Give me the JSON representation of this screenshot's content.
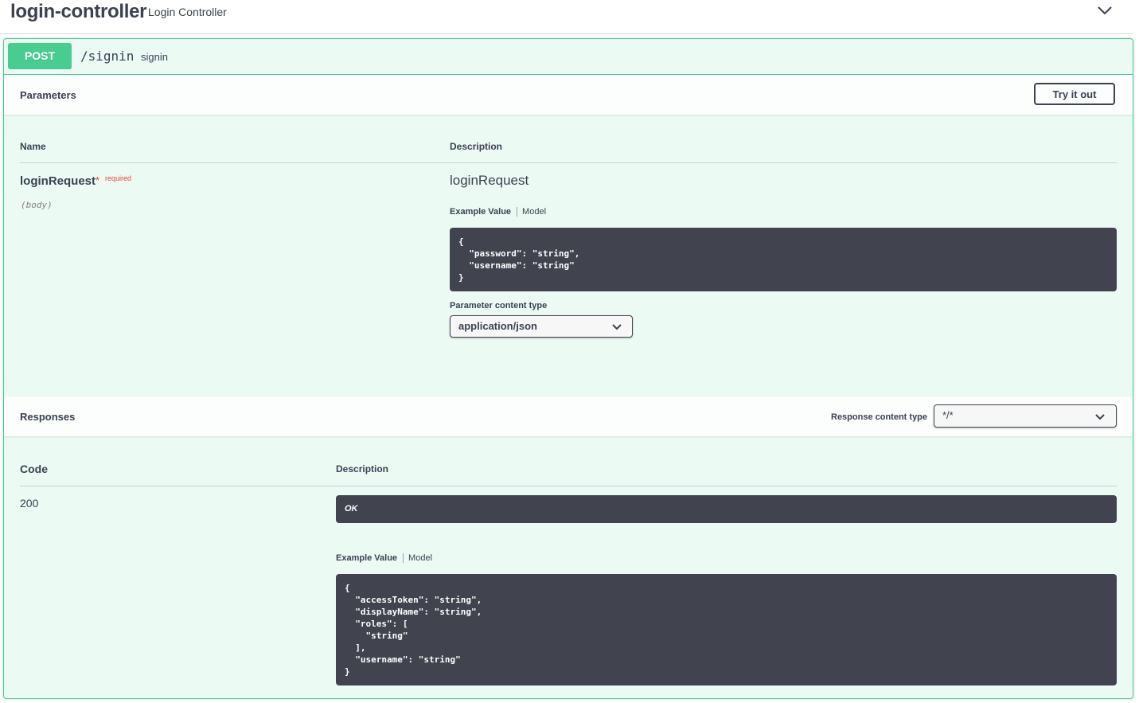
{
  "tag": {
    "name": "login-controller",
    "description": "Login Controller",
    "collapse_icon": "chevron-down-icon"
  },
  "operation": {
    "method": "POST",
    "path": "/signin",
    "summary": "signin",
    "method_color": "#49cc90"
  },
  "parameters": {
    "title": "Parameters",
    "try_button": "Try it out",
    "columns": {
      "name": "Name",
      "description": "Description"
    },
    "param": {
      "name": "loginRequest",
      "star": "*",
      "required": "required",
      "location": "(body)",
      "description": "loginRequest"
    },
    "tabs": {
      "example": "Example Value",
      "model": "Model"
    },
    "example_json": "{\n  \"password\": \"string\",\n  \"username\": \"string\"\n}",
    "content_type_label": "Parameter content type",
    "content_type": "application/json"
  },
  "responses": {
    "title": "Responses",
    "content_type_label": "Response content type",
    "content_type": "*/*",
    "columns": {
      "code": "Code",
      "description": "Description"
    },
    "items": [
      {
        "code": "200",
        "description": "OK",
        "tabs": {
          "example": "Example Value",
          "model": "Model"
        },
        "example_json": "{\n  \"accessToken\": \"string\",\n  \"displayName\": \"string\",\n  \"roles\": [\n    \"string\"\n  ],\n  \"username\": \"string\"\n}"
      }
    ]
  }
}
